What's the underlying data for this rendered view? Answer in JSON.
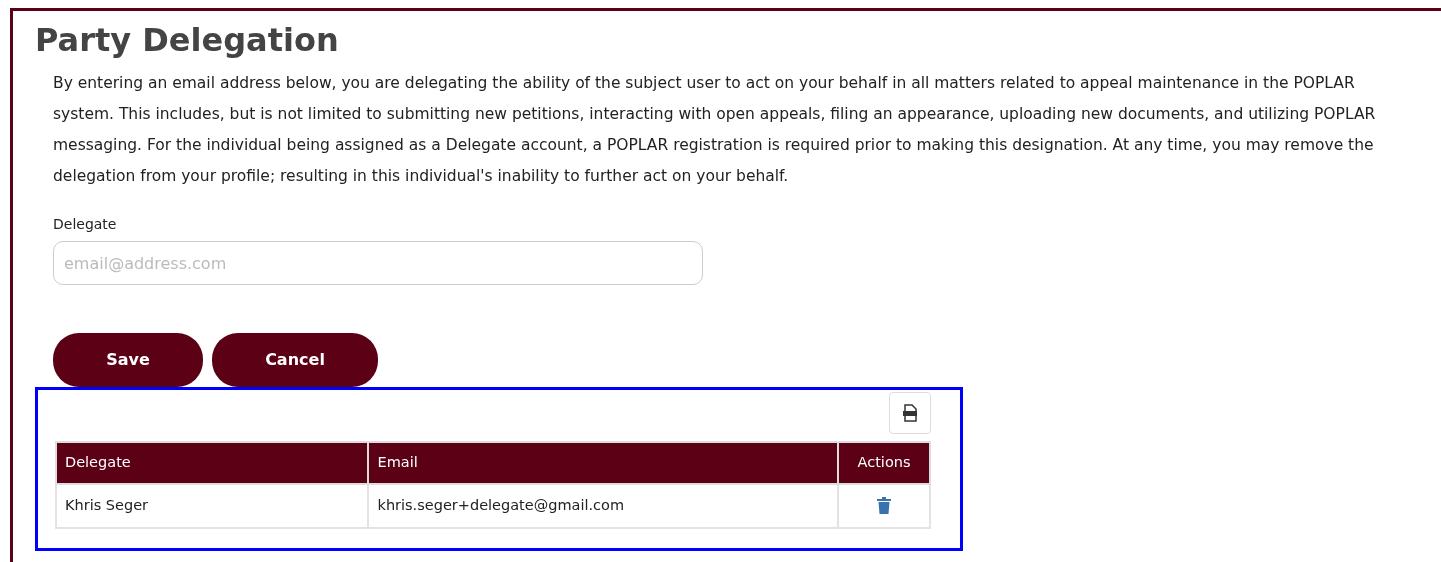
{
  "title": "Party Delegation",
  "description": "By entering an email address below, you are delegating the ability of the subject user to act on your behalf in all matters related to appeal maintenance in the POPLAR system. This includes, but is not limited to submitting new petitions, interacting with open appeals, filing an appearance, uploading new documents, and utilizing POPLAR messaging. For the individual being assigned as a Delegate account, a POPLAR registration is required prior to making this designation. At any time, you may remove the delegation from your profile; resulting in this individual's inability to further act on your behalf.",
  "field": {
    "label": "Delegate",
    "placeholder": "email@address.com"
  },
  "buttons": [
    "Save",
    "Cancel"
  ],
  "table": {
    "columns": [
      "Delegate",
      "Email",
      "Actions"
    ],
    "rows": [
      {
        "delegate": "Khris Seger",
        "email": "khris.seger+delegate@gmail.com"
      }
    ]
  }
}
